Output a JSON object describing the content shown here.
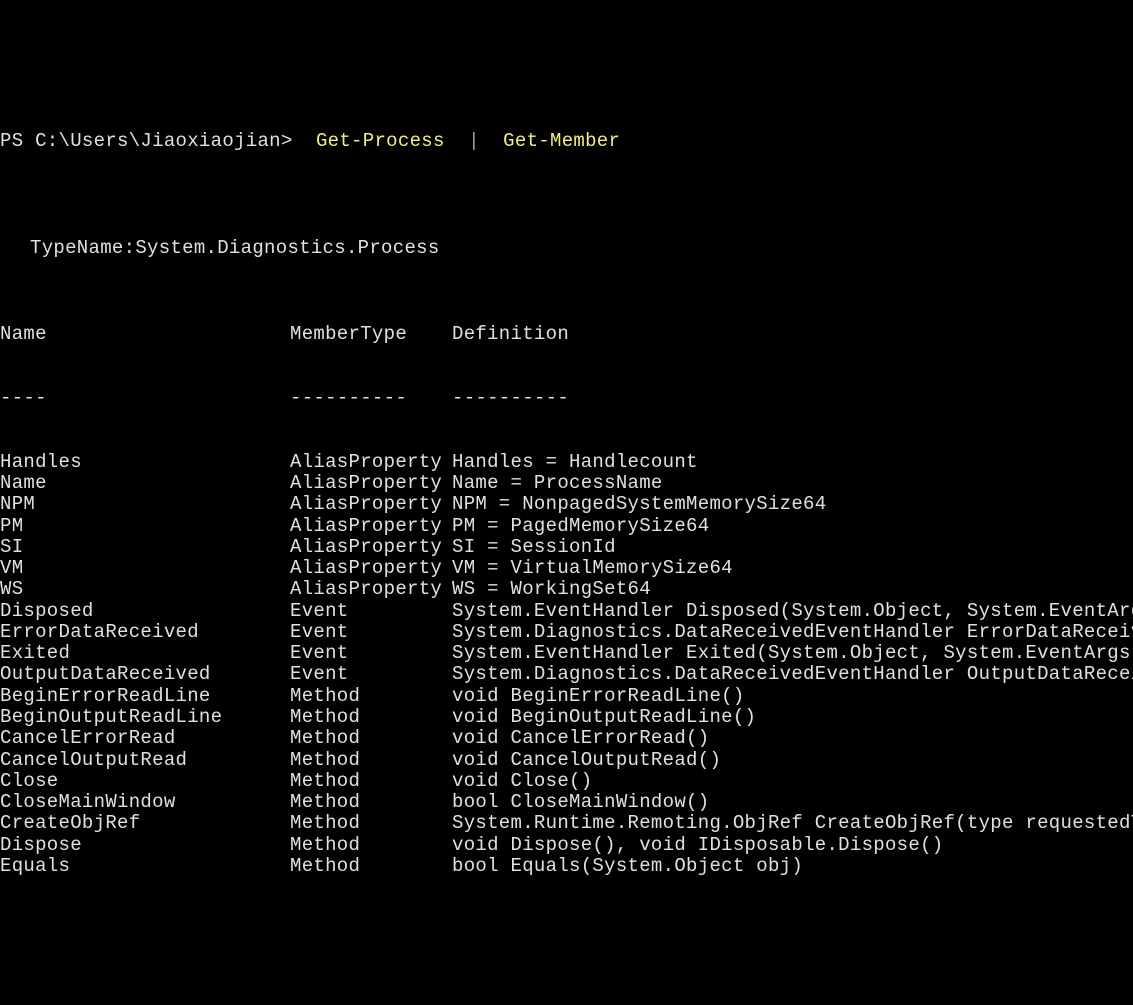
{
  "prompt": {
    "prefix": "PS C:\\Users\\Jiaoxiaojian> ",
    "command1": " Get-Process ",
    "pipe": " | ",
    "command2": " Get-Member"
  },
  "typename": "TypeName:System.Diagnostics.Process",
  "headers": {
    "name": "Name",
    "membertype": "MemberType",
    "definition": "Definition"
  },
  "dividers": {
    "name": "----",
    "membertype": "----------",
    "definition": "----------"
  },
  "rows": [
    {
      "name": "Handles",
      "type": "AliasProperty",
      "def": "Handles = Handlecount"
    },
    {
      "name": "Name",
      "type": "AliasProperty",
      "def": "Name = ProcessName"
    },
    {
      "name": "NPM",
      "type": "AliasProperty",
      "def": "NPM = NonpagedSystemMemorySize64"
    },
    {
      "name": "PM",
      "type": "AliasProperty",
      "def": "PM = PagedMemorySize64"
    },
    {
      "name": "SI",
      "type": "AliasProperty",
      "def": "SI = SessionId"
    },
    {
      "name": "VM",
      "type": "AliasProperty",
      "def": "VM = VirtualMemorySize64"
    },
    {
      "name": "WS",
      "type": "AliasProperty",
      "def": "WS = WorkingSet64"
    },
    {
      "name": "Disposed",
      "type": "Event",
      "def": "System.EventHandler Disposed(System.Object, System.EventArgs)"
    },
    {
      "name": "ErrorDataReceived",
      "type": "Event",
      "def": "System.Diagnostics.DataReceivedEventHandler ErrorDataReceived(Sy"
    },
    {
      "name": "Exited",
      "type": "Event",
      "def": "System.EventHandler Exited(System.Object, System.EventArgs)"
    },
    {
      "name": "OutputDataReceived",
      "type": "Event",
      "def": "System.Diagnostics.DataReceivedEventHandler OutputDataReceived(S"
    },
    {
      "name": "BeginErrorReadLine",
      "type": "Method",
      "def": "void BeginErrorReadLine()"
    },
    {
      "name": "BeginOutputReadLine",
      "type": "Method",
      "def": "void BeginOutputReadLine()"
    },
    {
      "name": "CancelErrorRead",
      "type": "Method",
      "def": "void CancelErrorRead()"
    },
    {
      "name": "CancelOutputRead",
      "type": "Method",
      "def": "void CancelOutputRead()"
    },
    {
      "name": "Close",
      "type": "Method",
      "def": "void Close()"
    },
    {
      "name": "CloseMainWindow",
      "type": "Method",
      "def": "bool CloseMainWindow()"
    },
    {
      "name": "CreateObjRef",
      "type": "Method",
      "def": "System.Runtime.Remoting.ObjRef CreateObjRef(type requestedType)"
    },
    {
      "name": "Dispose",
      "type": "Method",
      "def": "void Dispose(), void IDisposable.Dispose()"
    },
    {
      "name": "Equals",
      "type": "Method",
      "def": "bool Equals(System.Object obj)"
    }
  ]
}
